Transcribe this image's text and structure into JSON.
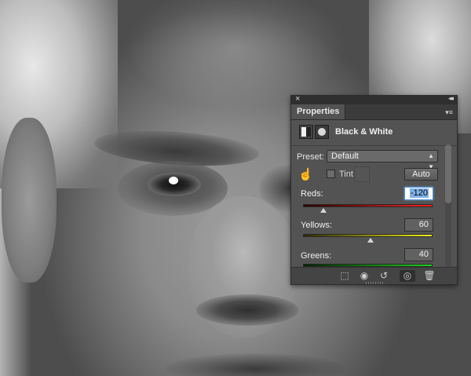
{
  "panel": {
    "tab_label": "Properties",
    "close_glyph": "×",
    "collapse_glyph": "◂◂",
    "menu_glyph": "▾≡",
    "adjustment_title": "Black & White",
    "preset_label": "Preset:",
    "preset_value": "Default",
    "tint_label": "Tint",
    "tint_checked": false,
    "auto_label": "Auto",
    "sliders": [
      {
        "label": "Reds:",
        "value": "-120",
        "min": -200,
        "max": 300,
        "colors": [
          "#2a0000",
          "#ff2020"
        ]
      },
      {
        "label": "Yellows:",
        "value": "60",
        "min": -200,
        "max": 300,
        "colors": [
          "#2a2a00",
          "#f0f020"
        ]
      },
      {
        "label": "Greens:",
        "value": "40",
        "min": -200,
        "max": 300,
        "colors": [
          "#002200",
          "#20d020"
        ]
      }
    ],
    "icons": {
      "adjustment": "black-white-adjustment-icon",
      "mask": "layer-mask-icon",
      "targeted_adjust": "targeted-adjustment-hand-icon",
      "clip": "clip-to-layer-icon",
      "view_previous": "view-previous-state-icon",
      "reset": "reset-adjustments-icon",
      "visibility": "visibility-eye-icon",
      "delete": "trash-icon"
    }
  }
}
